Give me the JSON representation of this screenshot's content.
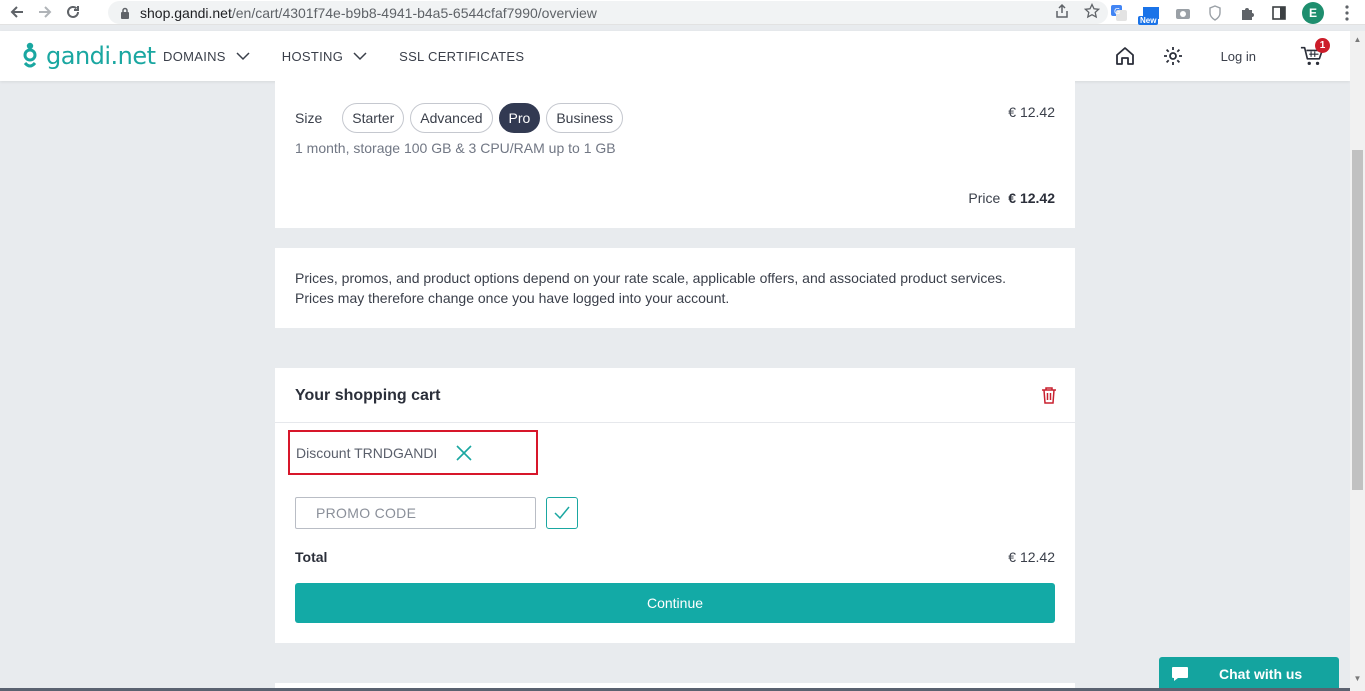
{
  "browser": {
    "url_host": "shop.gandi.net",
    "url_path": "/en/cart/4301f74e-b9b8-4941-b4a5-6544cfaf7990/overview",
    "new_badge": "New",
    "profile_initial": "E"
  },
  "header": {
    "logo_text": "gandi.net",
    "menu": [
      {
        "label": "DOMAINS"
      },
      {
        "label": "HOSTING"
      },
      {
        "label": "SSL CERTIFICATES"
      }
    ],
    "login_label": "Log in",
    "cart_count": "1"
  },
  "product": {
    "size_label": "Size",
    "sizes": [
      "Starter",
      "Advanced",
      "Pro",
      "Business"
    ],
    "selected_size": "Pro",
    "description": "1 month, storage 100 GB & 3 CPU/RAM up to 1 GB",
    "unit_price": "€ 12.42",
    "price_label": "Price",
    "price_value": "€ 12.42"
  },
  "notice": {
    "text": "Prices, promos, and product options depend on your rate scale, applicable offers, and associated product services. Prices may therefore change once you have logged into your account."
  },
  "cart": {
    "title": "Your shopping cart",
    "discount_text": "Discount TRNDGANDI",
    "promo_placeholder": "PROMO CODE",
    "total_label": "Total",
    "total_value": "€ 12.42",
    "continue_label": "Continue"
  },
  "chat": {
    "label": "Chat with us"
  },
  "colors": {
    "accent": "#13aaa6",
    "selected_chip": "#323a52",
    "highlight_border": "#d7162a",
    "badge": "#cc1d2a"
  }
}
